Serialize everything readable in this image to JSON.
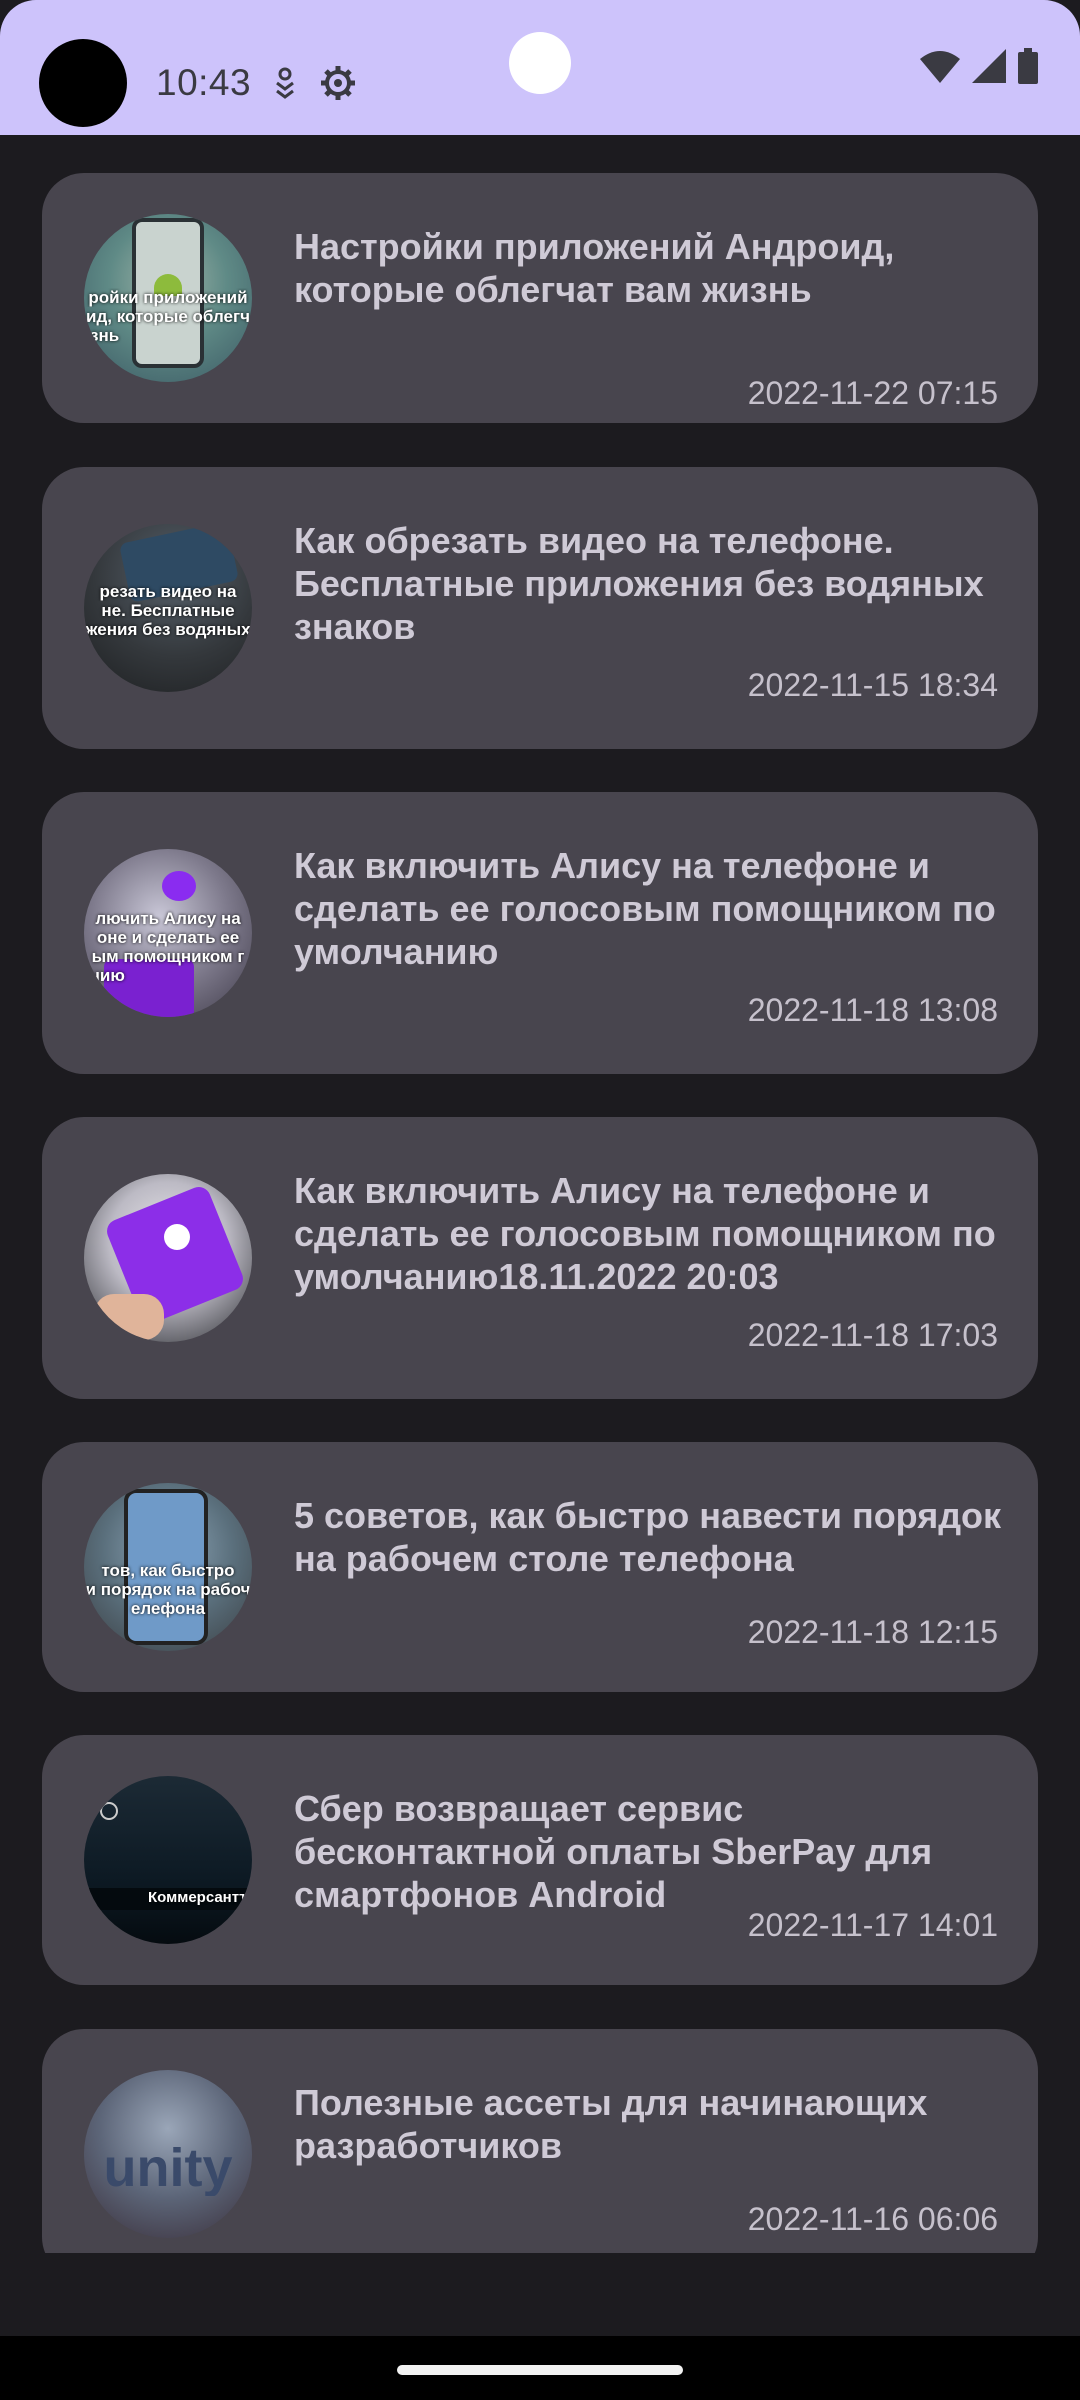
{
  "status_bar": {
    "time": "10:43",
    "icons": [
      "download-icon",
      "settings-gear-icon",
      "wifi-icon",
      "cellular-signal-icon",
      "battery-icon"
    ]
  },
  "articles": [
    {
      "title": "Настройки приложений Андроид, которые облегчат вам жизнь",
      "date": "2022-11-22 07:15",
      "thumb_text": [
        "ройки приложений",
        "ид, которые облегч",
        "знь"
      ]
    },
    {
      "title": "Как обрезать видео на телефоне. Бесплатные приложения без водяных знаков",
      "date": "2022-11-15 18:34",
      "thumb_text": [
        "резать видео на",
        "не. Бесплатные",
        "жения без водяных"
      ]
    },
    {
      "title": "Как включить Алису на телефоне и сделать ее голосовым помощником по умолчанию",
      "date": "2022-11-18 13:08",
      "thumb_text": [
        "лючить Алису на",
        "оне и сделать ее",
        "ым помощником г",
        "чию"
      ]
    },
    {
      "title": "Как включить Алису на телефоне и сделать ее голосовым помощником по умолчанию18.11.2022 20:03",
      "date": "2022-11-18 17:03",
      "thumb_text": []
    },
    {
      "title": "5 советов, как быстро навести порядок на рабочем столе телефона",
      "date": "2022-11-18 12:15",
      "thumb_text": [
        "тов, как быстро",
        "и порядок на рабоч",
        "елефона"
      ]
    },
    {
      "title": "Сбер возвращает сервис бесконтактной оплаты SberPay для смартфонов Android",
      "date": "2022-11-17 14:01",
      "thumb_text": [
        "Коммерсантъ"
      ]
    },
    {
      "title": "Полезные ассеты для начинающих разработчиков",
      "date": "2022-11-16 06:06",
      "thumb_text": [
        "unity"
      ]
    }
  ]
}
